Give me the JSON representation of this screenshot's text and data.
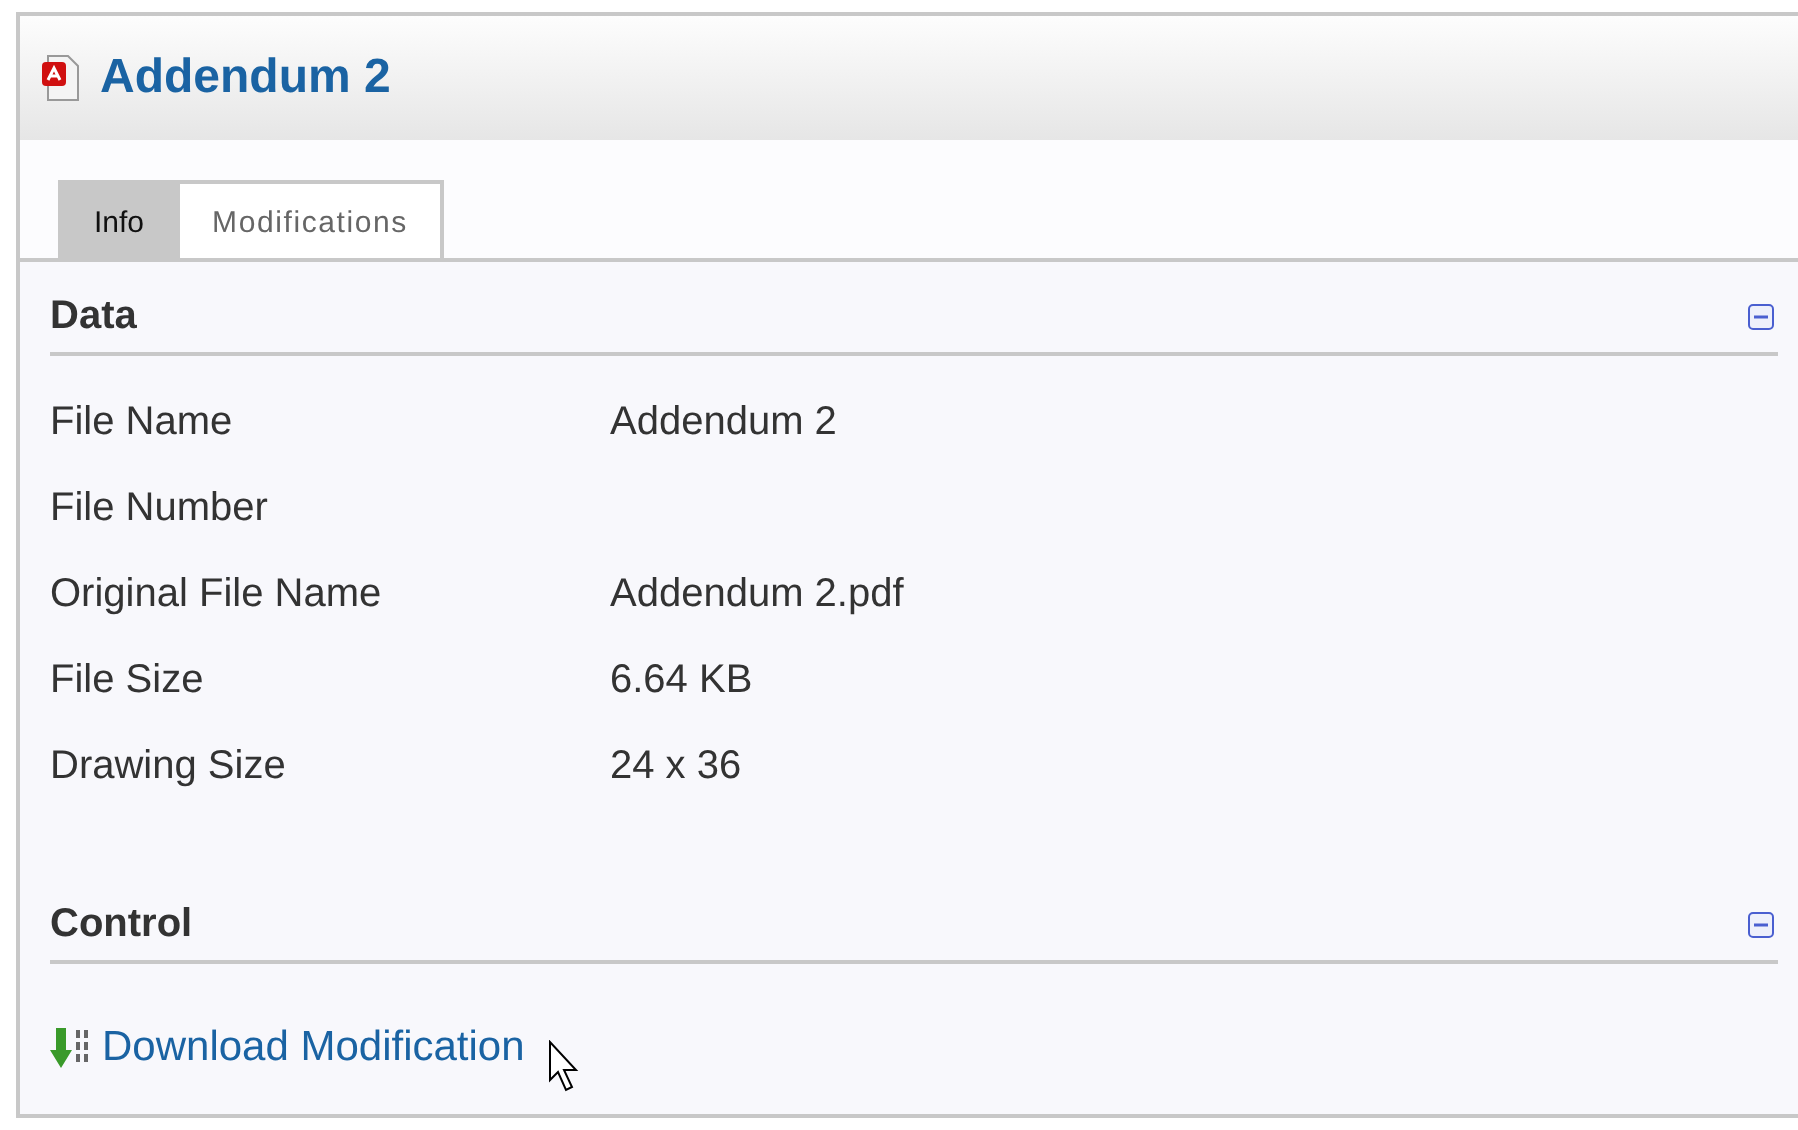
{
  "title": "Addendum 2",
  "tabs": [
    {
      "label": "Info",
      "selected": true
    },
    {
      "label": "Modifications",
      "selected": false
    }
  ],
  "sections": [
    {
      "heading": "Data",
      "expanded": true,
      "kind": "fields",
      "rows": [
        {
          "label": "File Name",
          "value": "Addendum 2"
        },
        {
          "label": "File Number"
        },
        {
          "label": "Original File Name",
          "value": "Addendum 2.pdf"
        },
        {
          "label": "File Size",
          "value": "6.64 KB"
        },
        {
          "label": "Drawing Size",
          "value": "24 x 36"
        }
      ]
    },
    {
      "heading": "Control",
      "expanded": true,
      "kind": "links",
      "links": [
        "Download Modification"
      ]
    }
  ]
}
